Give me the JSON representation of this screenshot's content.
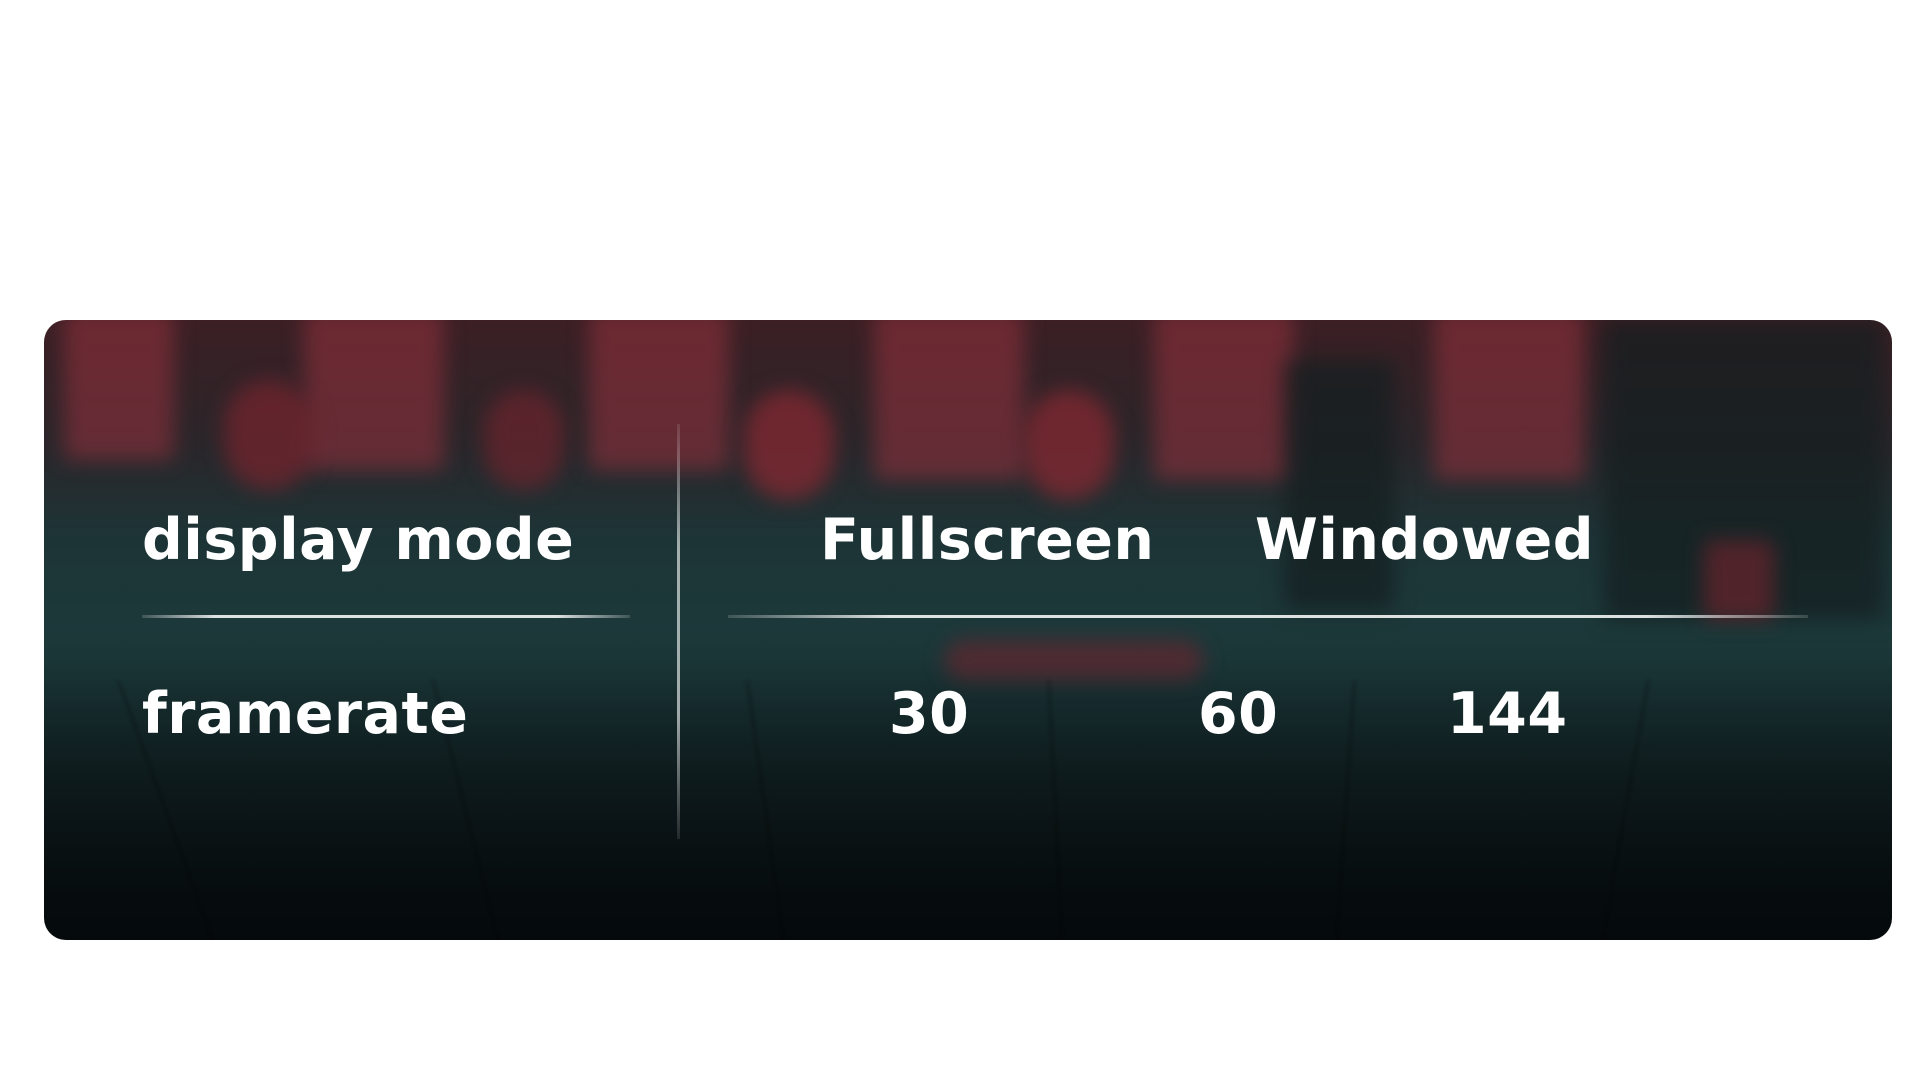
{
  "settings": {
    "display_mode": {
      "label": "display mode",
      "options": [
        "Fullscreen",
        "Windowed"
      ]
    },
    "framerate": {
      "label": "framerate",
      "options": [
        "30",
        "60",
        "144"
      ]
    }
  },
  "colors": {
    "text": "#ffffff",
    "panel_top": "#3b1f24",
    "panel_mid": "#1c3a3b",
    "panel_bottom": "#0b1416",
    "accent_red": "#96323e"
  }
}
